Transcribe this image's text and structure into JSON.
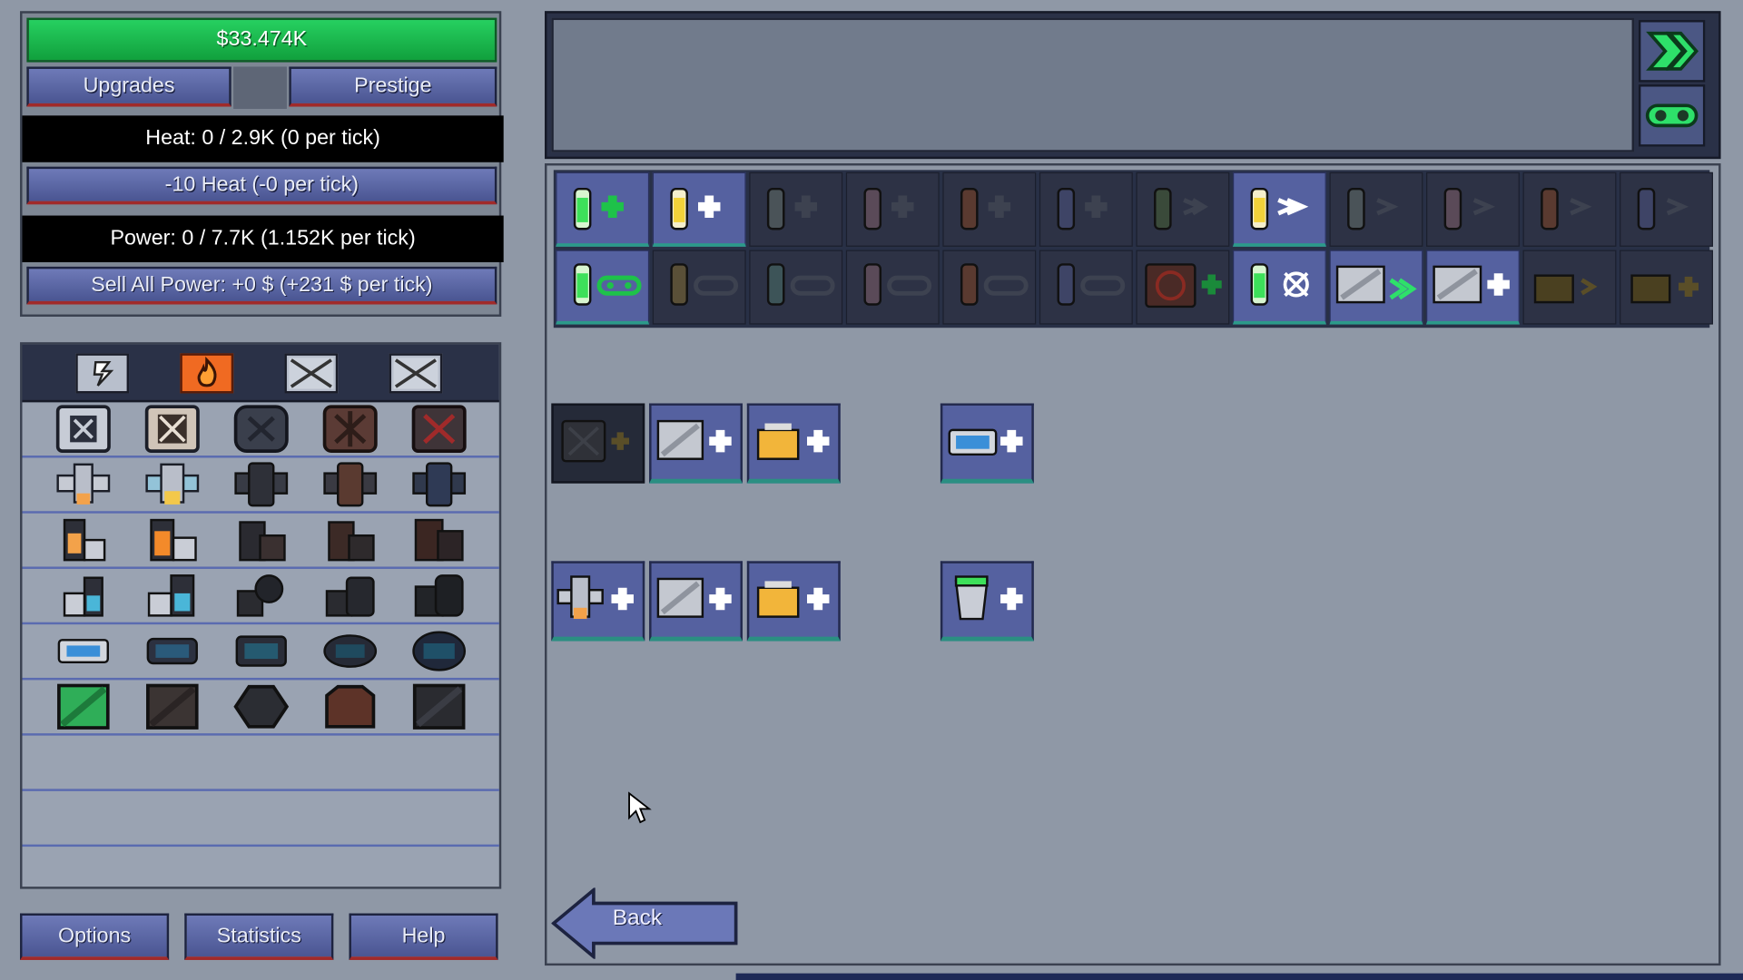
{
  "money": "$33.474K",
  "buttons": {
    "upgrades": "Upgrades",
    "prestige": "Prestige",
    "vent_heat": "-10 Heat (-0 per tick)",
    "sell_power": "Sell All Power: +0 $ (+231 $ per tick)",
    "options": "Options",
    "statistics": "Statistics",
    "help": "Help",
    "back": "Back"
  },
  "stats": {
    "heat": "Heat: 0 / 2.9K (0 per tick)",
    "power": "Power: 0 / 7.7K (1.152K per tick)"
  },
  "colors": {
    "money_bar": "#1fc255",
    "button": "#5b66a6",
    "selected_tab": "#f06a22",
    "panel_dark": "#2a3147"
  },
  "inventory_tabs": [
    "power-tab-icon",
    "heat-tab-icon",
    "locked-tab-icon",
    "locked-tab-icon"
  ],
  "inventory_rows": [
    [
      "vent-icon",
      "vent-icon",
      "vent-icon",
      "vent-icon",
      "vent-icon"
    ],
    [
      "exchanger-icon",
      "exchanger-icon",
      "exchanger-icon",
      "exchanger-icon",
      "exchanger-icon"
    ],
    [
      "heat-inlet-icon",
      "heat-inlet-icon",
      "heat-inlet-icon",
      "heat-inlet-icon",
      "heat-inlet-icon"
    ],
    [
      "heat-outlet-icon",
      "heat-outlet-icon",
      "heat-outlet-icon",
      "heat-outlet-icon",
      "heat-outlet-icon"
    ],
    [
      "coolant-cell-icon",
      "coolant-cell-icon",
      "coolant-cell-icon",
      "coolant-cell-icon",
      "coolant-cell-icon"
    ],
    [
      "plating-icon",
      "plating-icon",
      "plating-icon",
      "plating-icon",
      "plating-icon"
    ]
  ]
}
